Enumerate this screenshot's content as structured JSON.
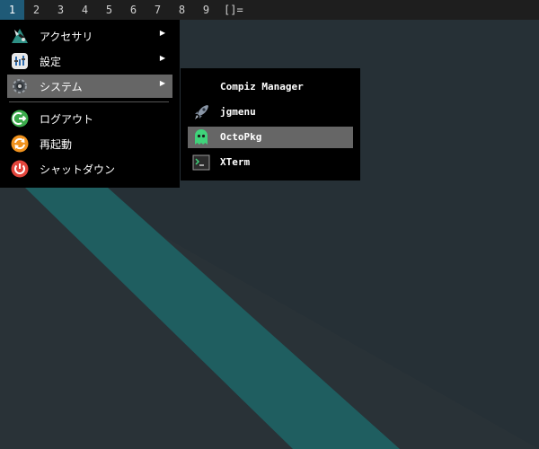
{
  "topbar": {
    "workspaces": [
      "1",
      "2",
      "3",
      "4",
      "5",
      "6",
      "7",
      "8",
      "9"
    ],
    "active_workspace": "1",
    "layout_symbol": "[]="
  },
  "main_menu": {
    "items": [
      {
        "label": "アクセサリ",
        "icon": "accessories-icon",
        "has_submenu": true
      },
      {
        "label": "設定",
        "icon": "settings-icon",
        "has_submenu": true
      },
      {
        "label": "システム",
        "icon": "system-gear-icon",
        "has_submenu": true,
        "selected": true
      },
      {
        "label": "ログアウト",
        "icon": "logout-icon",
        "has_submenu": false
      },
      {
        "label": "再起動",
        "icon": "restart-icon",
        "has_submenu": false
      },
      {
        "label": "シャットダウン",
        "icon": "power-icon",
        "has_submenu": false
      }
    ],
    "arrow": "▶"
  },
  "system_submenu": {
    "items": [
      {
        "label": "Compiz Manager",
        "icon": ""
      },
      {
        "label": "jgmenu",
        "icon": "rocket-icon"
      },
      {
        "label": "OctoPkg",
        "icon": "octopkg-ghost-icon",
        "selected": true
      },
      {
        "label": "XTerm",
        "icon": "terminal-icon"
      }
    ]
  },
  "colors": {
    "background": "#263036",
    "stripe": "#1f5e60",
    "menu_bg": "#000000",
    "selection": "#666666",
    "active_workspace": "#1f5a77"
  }
}
